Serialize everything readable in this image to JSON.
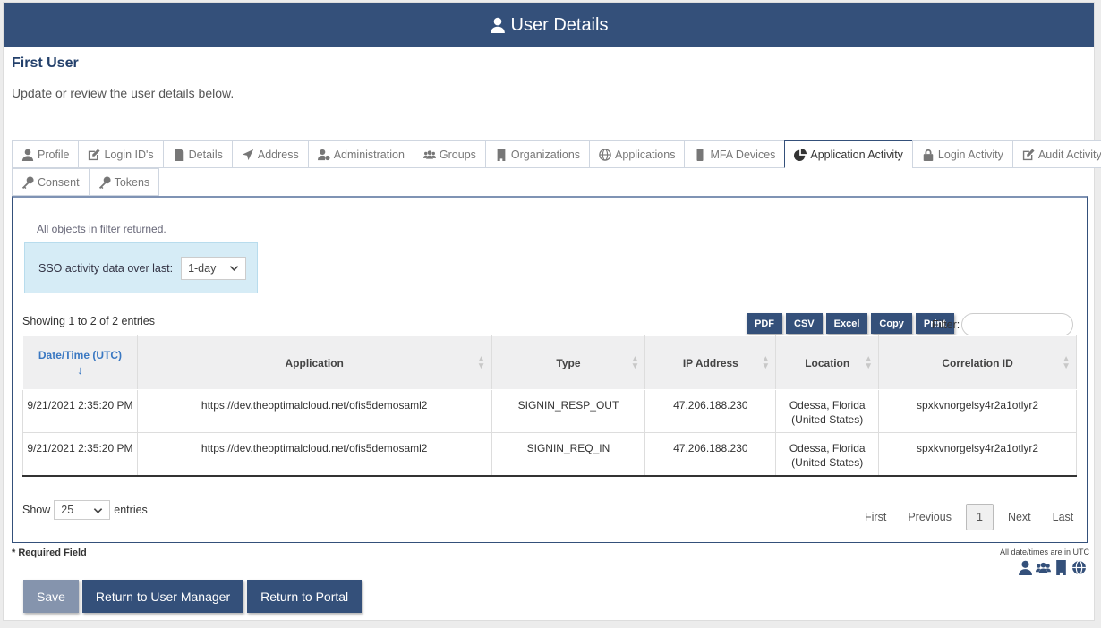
{
  "header": {
    "title": "User Details"
  },
  "user": {
    "name": "First User",
    "subtitle": "Update or review the user details below."
  },
  "tabs": [
    {
      "label": "Profile",
      "icon": "user-icon"
    },
    {
      "label": "Login ID's",
      "icon": "edit-icon"
    },
    {
      "label": "Details",
      "icon": "file-icon"
    },
    {
      "label": "Address",
      "icon": "location-arrow-icon"
    },
    {
      "label": "Administration",
      "icon": "user-cog-icon"
    },
    {
      "label": "Groups",
      "icon": "users-icon"
    },
    {
      "label": "Organizations",
      "icon": "building-icon"
    },
    {
      "label": "Applications",
      "icon": "globe-icon"
    },
    {
      "label": "MFA Devices",
      "icon": "mobile-icon"
    },
    {
      "label": "Application Activity",
      "icon": "pie-chart-icon",
      "active": true
    },
    {
      "label": "Login Activity",
      "icon": "lock-icon"
    },
    {
      "label": "Audit Activity",
      "icon": "edit-icon"
    },
    {
      "label": "Consent",
      "icon": "key-icon"
    },
    {
      "label": "Tokens",
      "icon": "key-icon"
    }
  ],
  "panel": {
    "filter_note": "All objects in filter returned.",
    "sso_label": "SSO activity data over last:",
    "sso_value": "1-day",
    "showing": "Showing 1 to 2 of 2 entries",
    "export_buttons": [
      "PDF",
      "CSV",
      "Excel",
      "Copy",
      "Print"
    ],
    "filter_label": "Filter:",
    "filter_value": ""
  },
  "table": {
    "columns": [
      "Date/Time (UTC)",
      "Application",
      "Type",
      "IP Address",
      "Location",
      "Correlation ID"
    ],
    "sorted_indicator": "↓",
    "rows": [
      [
        "9/21/2021 2:35:20 PM",
        "https://dev.theoptimalcloud.net/ofis5demosaml2",
        "SIGNIN_RESP_OUT",
        "47.206.188.230",
        "Odessa, Florida (United States)",
        "spxkvnorgelsy4r2a1otlyr2"
      ],
      [
        "9/21/2021 2:35:20 PM",
        "https://dev.theoptimalcloud.net/ofis5demosaml2",
        "SIGNIN_REQ_IN",
        "47.206.188.230",
        "Odessa, Florida (United States)",
        "spxkvnorgelsy4r2a1otlyr2"
      ]
    ]
  },
  "length_menu": {
    "show": "Show",
    "value": "25",
    "entries": "entries"
  },
  "pager": {
    "first": "First",
    "previous": "Previous",
    "current": "1",
    "next": "Next",
    "last": "Last"
  },
  "footer": {
    "required": "* Required Field",
    "utc_note": "All date/times are in UTC",
    "icons": [
      "user-icon",
      "users-icon",
      "building-icon",
      "globe-icon"
    ]
  },
  "actions": {
    "save": "Save",
    "return_user_manager": "Return to User Manager",
    "return_portal": "Return to Portal"
  },
  "colors": {
    "primary": "#34507a",
    "sso_box": "#d6ecf6",
    "sort_link": "#3a78c2"
  }
}
